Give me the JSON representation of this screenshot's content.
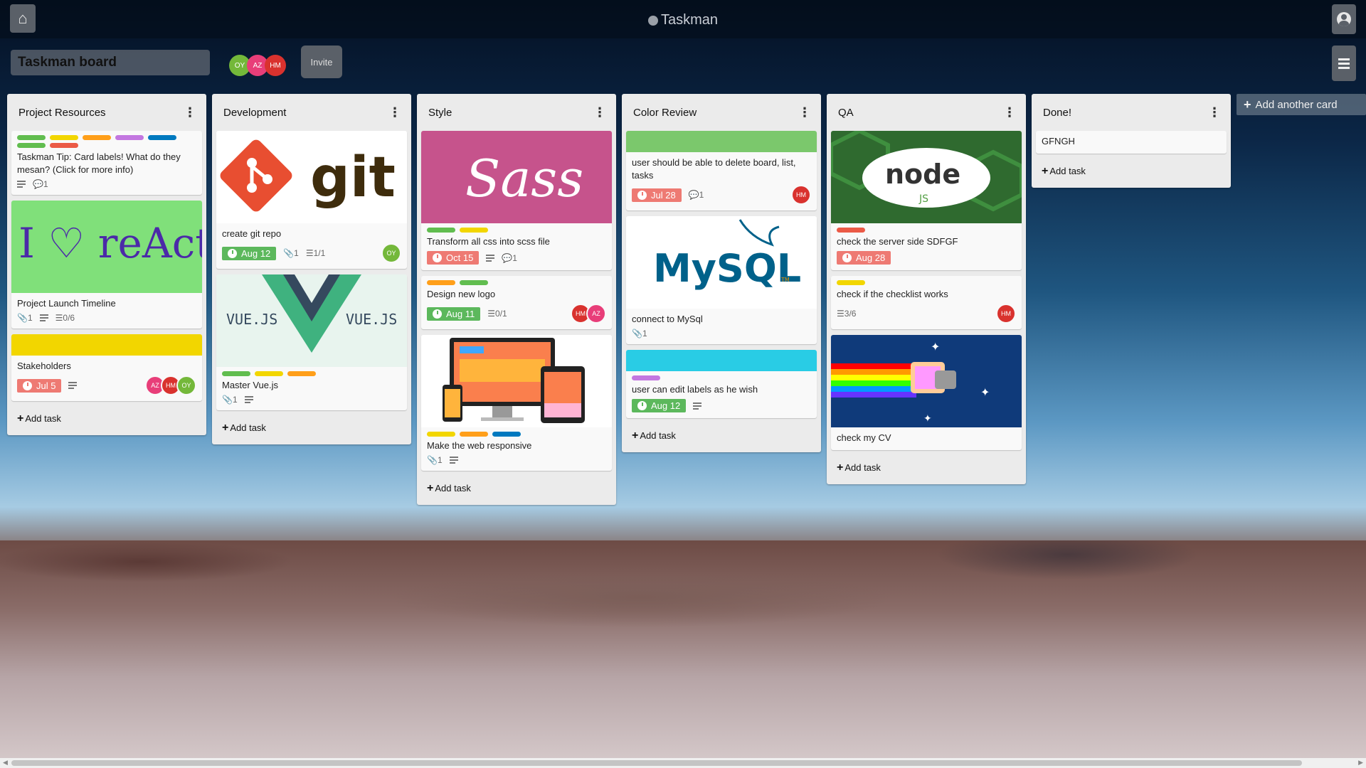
{
  "navbar": {
    "app_title": "Taskman"
  },
  "board": {
    "title": "Taskman board",
    "members": [
      "OY",
      "AZ",
      "HM"
    ],
    "invite_label": "Invite"
  },
  "lists": [
    {
      "title": "Project Resources",
      "add_task": "Add task",
      "cards": [
        {
          "title": "Taskman Tip: Card labels! What do they mesan? (Click for more info)",
          "comments": "1"
        },
        {
          "cover_text": "I ♡ reAct",
          "title": "Project Launch Timeline",
          "attachments": "1",
          "checklist": "0/6"
        },
        {
          "title": "Stakeholders",
          "date": "Jul 5",
          "avatars": [
            "AZ",
            "HM",
            "OY"
          ]
        }
      ]
    },
    {
      "title": "Development",
      "add_task": "Add task",
      "cards": [
        {
          "cover_text": "git",
          "title": "create git repo",
          "date": "Aug 12",
          "attachments": "1",
          "checklist": "1/1",
          "avatars": [
            "OY"
          ]
        },
        {
          "cover_text": "VUE.JS",
          "title": "Master Vue.js",
          "attachments": "1"
        }
      ]
    },
    {
      "title": "Style",
      "add_task": "Add task",
      "cards": [
        {
          "cover_text": "Sass",
          "title": "Transform all css into scss file",
          "date": "Oct 15",
          "comments": "1"
        },
        {
          "title": "Design new logo",
          "date": "Aug 11",
          "checklist": "0/1",
          "avatars": [
            "HM",
            "AZ"
          ]
        },
        {
          "title": "Make the web responsive",
          "attachments": "1"
        }
      ]
    },
    {
      "title": "Color Review",
      "add_task": "Add task",
      "cards": [
        {
          "title": "user should be able to delete board, list, tasks",
          "date": "Jul 28",
          "comments": "1",
          "avatars": [
            "HM"
          ]
        },
        {
          "cover_text": "MySQL",
          "cover_tm": "TM",
          "title": "connect to MySql",
          "attachments": "1"
        },
        {
          "title": "user can edit labels as he wish",
          "date": "Aug 12"
        }
      ]
    },
    {
      "title": "QA",
      "add_task": "Add task",
      "cards": [
        {
          "cover_text": "node",
          "cover_sub": "JS",
          "title": "check the server side SDFGF",
          "date": "Aug 28"
        },
        {
          "title": "check if the checklist works",
          "checklist": "3/6",
          "avatars": [
            "HM"
          ]
        },
        {
          "title": "check my CV"
        }
      ]
    },
    {
      "title": "Done!",
      "add_task": "Add task",
      "cards": [
        {
          "title": "GFNGH"
        }
      ]
    }
  ],
  "add_list_label": "Add another card",
  "colors": {
    "label_green": "#61bd4f",
    "label_yellow": "#f2d600",
    "label_orange": "#ff9f1a",
    "label_red": "#eb5a46",
    "label_purple": "#c377e0",
    "label_blue": "#0079bf",
    "label_sky": "#29cce5",
    "date_overdue": "#ee7a73",
    "date_done": "#5cb85c"
  }
}
